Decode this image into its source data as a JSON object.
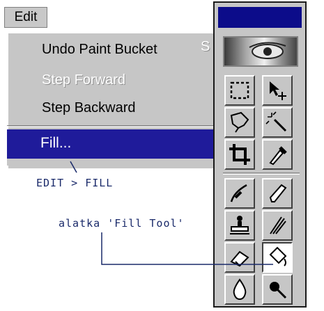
{
  "menubar": {
    "edit_label": "Edit"
  },
  "edit_menu": {
    "items": [
      {
        "label": "Undo Paint Bucket",
        "enabled": true
      },
      {
        "label": "Step Forward",
        "enabled": false
      },
      {
        "label": "Step Backward",
        "enabled": true
      }
    ],
    "shortcut_partial": "S",
    "highlighted_item": "Fill..."
  },
  "annotations": {
    "menu_path": "EDIT > FILL",
    "tool_note": "alatka 'Fill Tool'"
  },
  "palette": {
    "tools": [
      {
        "name": "marquee-tool-icon"
      },
      {
        "name": "move-tool-icon"
      },
      {
        "name": "lasso-tool-icon"
      },
      {
        "name": "magic-wand-tool-icon"
      },
      {
        "name": "crop-tool-icon"
      },
      {
        "name": "eyedropper-tool-icon"
      },
      {
        "name": "airbrush-tool-icon"
      },
      {
        "name": "pencil-tool-icon"
      },
      {
        "name": "rubber-stamp-tool-icon"
      },
      {
        "name": "smudge-tool-icon"
      },
      {
        "name": "eraser-tool-icon"
      },
      {
        "name": "paint-bucket-tool-icon",
        "active": true
      },
      {
        "name": "blur-tool-icon"
      },
      {
        "name": "burn-tool-icon"
      }
    ]
  },
  "colors": {
    "highlight": "#1f1b9a",
    "titlebar": "#0c0c8a",
    "annotation": "#1a2a6a"
  }
}
